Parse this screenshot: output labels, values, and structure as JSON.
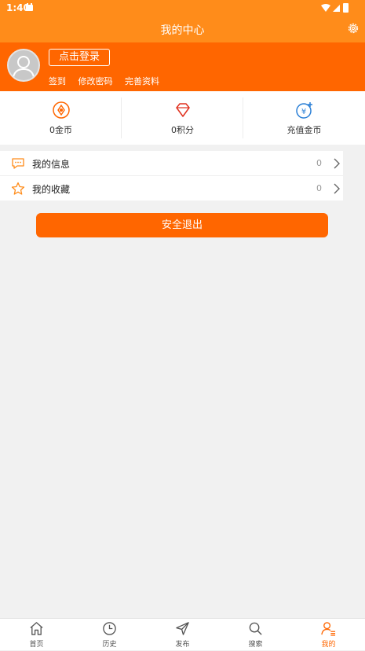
{
  "status_bar": {
    "time": "1:40"
  },
  "header": {
    "title": "我的中心",
    "settings_icon": "gear-icon"
  },
  "profile": {
    "login_label": "点击登录",
    "links": [
      "签到",
      "修改密码",
      "完善资料"
    ],
    "avatar_icon": "user-silhouette-icon"
  },
  "stats": [
    {
      "label": "0金币",
      "icon": "coin-flower-icon"
    },
    {
      "label": "0积分",
      "icon": "diamond-icon"
    },
    {
      "label": "充值金币",
      "icon": "yen-coin-plus-icon"
    }
  ],
  "menu": [
    {
      "label": "我的信息",
      "count": "0",
      "icon": "message-icon"
    },
    {
      "label": "我的收藏",
      "count": "0",
      "icon": "star-icon"
    }
  ],
  "logout_label": "安全退出",
  "tabs": [
    {
      "label": "首页",
      "icon": "home-icon",
      "active": false
    },
    {
      "label": "历史",
      "icon": "clock-icon",
      "active": false
    },
    {
      "label": "发布",
      "icon": "send-icon",
      "active": false
    },
    {
      "label": "搜索",
      "icon": "search-icon",
      "active": false
    },
    {
      "label": "我的",
      "icon": "profile-icon",
      "active": true
    }
  ],
  "colors": {
    "primary": "#ff6600",
    "header": "#ff8c1a",
    "background": "#f1f1f1"
  }
}
